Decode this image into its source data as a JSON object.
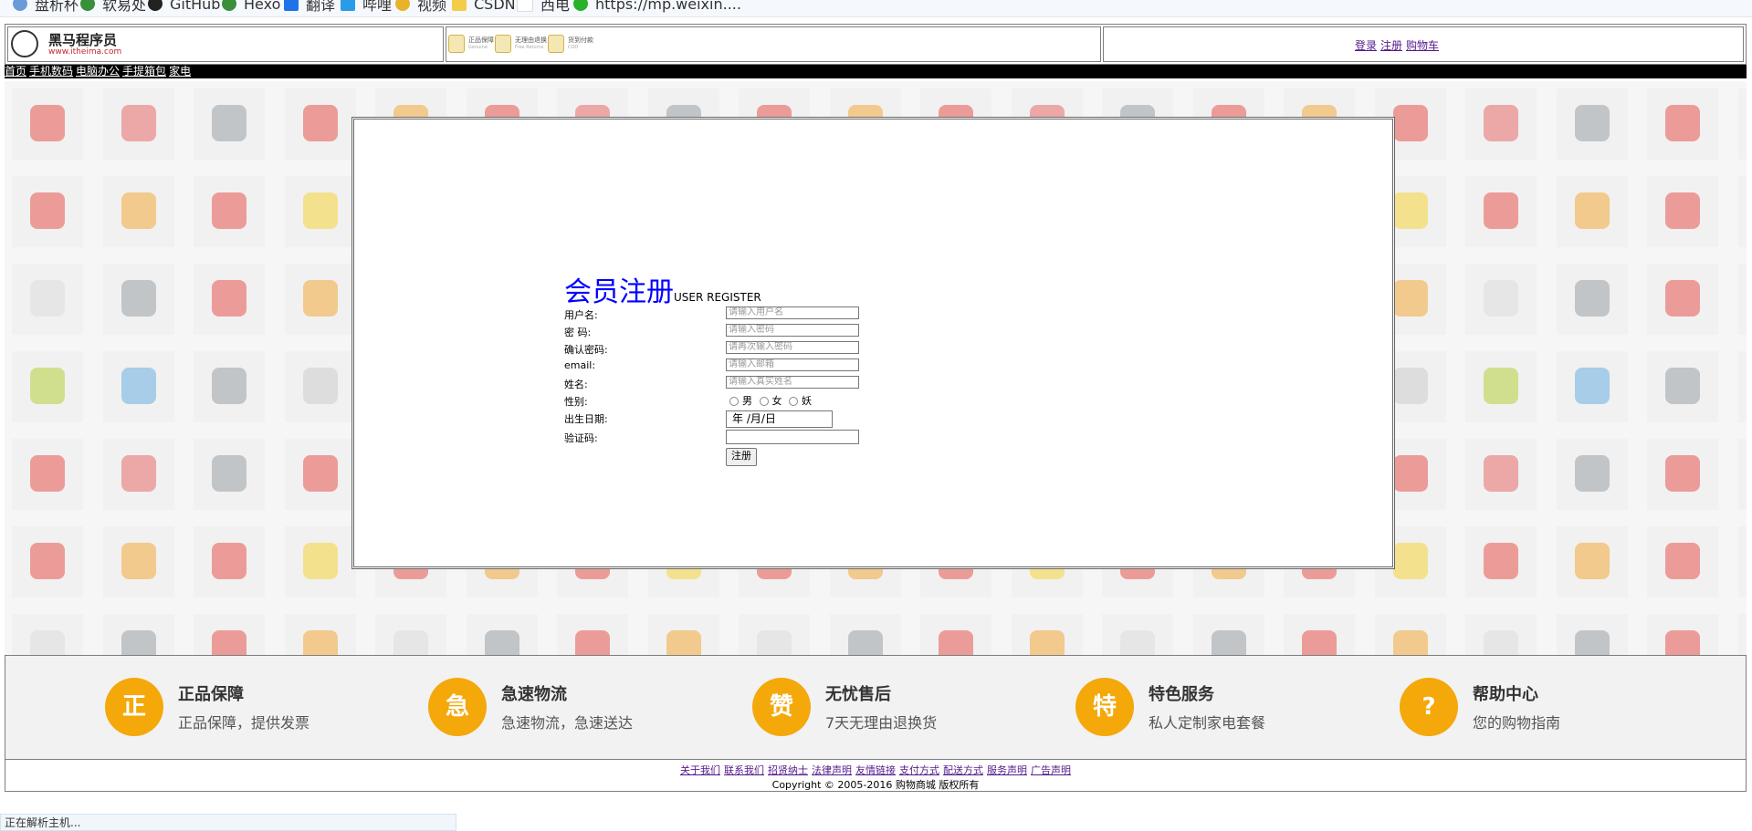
{
  "bookmarks": [
    {
      "label": "盘析杯",
      "icon": "globe-icon"
    },
    {
      "label": "软易处",
      "icon": "globe-icon"
    },
    {
      "label": "GitHub",
      "icon": "github-icon"
    },
    {
      "label": "Hexo",
      "icon": "globe-icon"
    },
    {
      "label": "翻译",
      "icon": "translate-icon"
    },
    {
      "label": "哔哩",
      "icon": "bilibili-icon"
    },
    {
      "label": "视频",
      "icon": "video-icon"
    },
    {
      "label": "CSDN",
      "icon": "folder-icon"
    },
    {
      "label": "西电",
      "icon": "page-icon"
    },
    {
      "label": "https://mp.weixin....",
      "icon": "wechat-icon"
    }
  ],
  "header": {
    "logo_title": "黑马程序员",
    "logo_sub": "www.itheima.com",
    "features": [
      {
        "title": "正品保障",
        "sub": "Genuine"
      },
      {
        "title": "无理由退换",
        "sub": "Free Returns"
      },
      {
        "title": "货到付款",
        "sub": "COD"
      }
    ],
    "links": [
      "登录",
      "注册",
      "购物车"
    ]
  },
  "nav": [
    "首页",
    "手机数码",
    "电脑办公",
    "手提箱包",
    "家电"
  ],
  "form": {
    "title": "会员注册",
    "subtitle": "USER REGISTER",
    "fields": [
      {
        "label": "用户名:",
        "placeholder": "请输入用户名"
      },
      {
        "label": "密 码:",
        "placeholder": "请输入密码"
      },
      {
        "label": "确认密码:",
        "placeholder": "请再次输入密码"
      },
      {
        "label": "email:",
        "placeholder": "请输入邮箱"
      },
      {
        "label": "姓名:",
        "placeholder": "请输入真实姓名"
      }
    ],
    "gender_label": "性别:",
    "gender_options": [
      "男",
      "女",
      "妖"
    ],
    "birth_label": "出生日期:",
    "birth_value": "年 /月/日",
    "captcha_label": "验证码:",
    "submit": "注册"
  },
  "services": [
    {
      "icon": "正",
      "title": "正品保障",
      "desc": "正品保障，提供发票"
    },
    {
      "icon": "急",
      "title": "急速物流",
      "desc": "急速物流，急速送达"
    },
    {
      "icon": "赞",
      "title": "无忧售后",
      "desc": "7天无理由退换货"
    },
    {
      "icon": "特",
      "title": "特色服务",
      "desc": "私人定制家电套餐"
    },
    {
      "icon": "?",
      "title": "帮助中心",
      "desc": "您的购物指南"
    }
  ],
  "footer": {
    "links": [
      "关于我们",
      "联系我们",
      "招贤纳士",
      "法律声明",
      "友情链接",
      "支付方式",
      "配送方式",
      "服务声明",
      "广告声明"
    ],
    "copyright": "Copyright © 2005-2016 购物商城 版权所有"
  },
  "status": "正在解析主机..."
}
